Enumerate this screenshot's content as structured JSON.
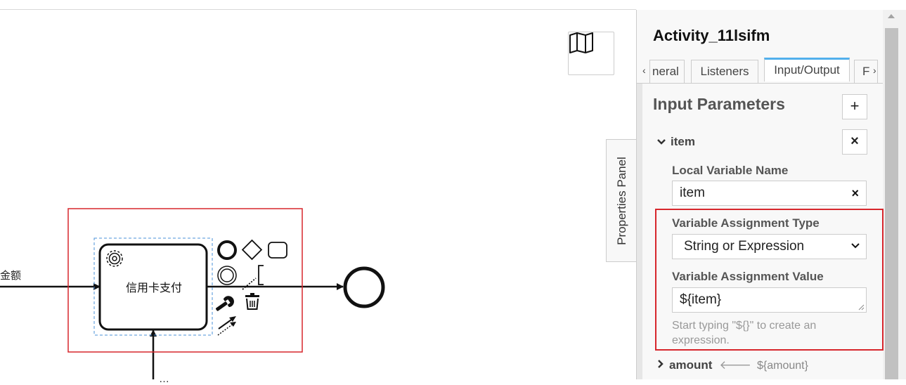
{
  "canvas": {
    "incoming_flow_label": "金额",
    "bottom_flow_label": "…",
    "task_name": "信用卡支付",
    "minimap_icon": "map-icon"
  },
  "panel": {
    "toggle_label": "Properties Panel",
    "title": "Activity_11lsifm",
    "tabs": [
      {
        "label": "General",
        "visible_text": "neral"
      },
      {
        "label": "Listeners"
      },
      {
        "label": "Input/Output",
        "active": true
      },
      {
        "label": "F"
      }
    ],
    "tab_scroll_left": "‹",
    "tab_scroll_right": "›",
    "input_parameters": {
      "title": "Input Parameters",
      "add_label": "+",
      "item": {
        "name": "item",
        "remove_label": "×",
        "local_variable_name_label": "Local Variable Name",
        "local_variable_name_value": "item",
        "clear_label": "×",
        "assignment_type_label": "Variable Assignment Type",
        "assignment_type_value": "String or Expression",
        "assignment_value_label": "Variable Assignment Value",
        "assignment_value": "${item}",
        "hint": "Start typing \"${}\" to create an expression."
      },
      "amount": {
        "name": "amount",
        "value": "${amount}"
      }
    }
  },
  "colors": {
    "accent": "#52b0ec",
    "highlight": "#d7262c",
    "selection": "#4a90d9"
  }
}
